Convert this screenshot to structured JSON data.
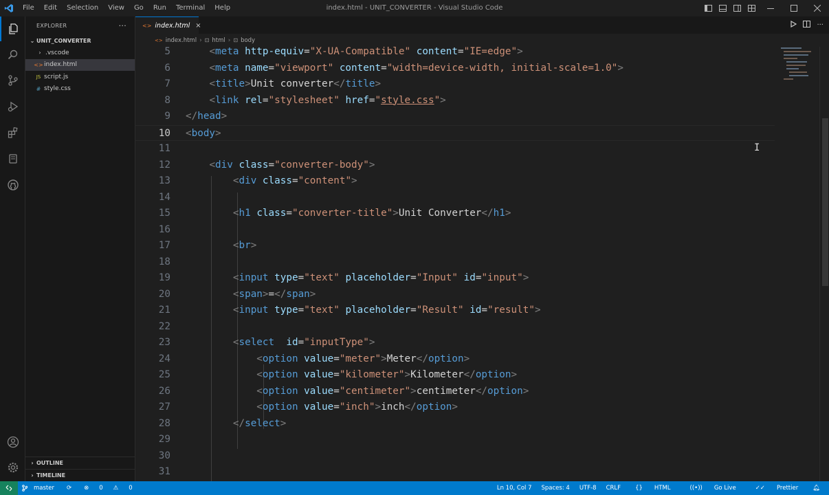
{
  "window": {
    "title": "index.html - UNIT_CONVERTER - Visual Studio Code",
    "menu": [
      "File",
      "Edit",
      "Selection",
      "View",
      "Go",
      "Run",
      "Terminal",
      "Help"
    ]
  },
  "sidebar": {
    "header": "EXPLORER",
    "more": "···",
    "folder": "UNIT_CONVERTER",
    "items": [
      {
        "label": ".vscode",
        "icon": "chevron-right-icon"
      },
      {
        "label": "index.html",
        "icon": "html-file-icon"
      },
      {
        "label": "script.js",
        "icon": "js-file-icon"
      },
      {
        "label": "style.css",
        "icon": "css-file-icon"
      }
    ],
    "sections": [
      "OUTLINE",
      "TIMELINE"
    ]
  },
  "editor": {
    "tab": {
      "label": "index.html",
      "close": "×"
    },
    "breadcrumb": [
      "index.html",
      "html",
      "body"
    ],
    "lines": [
      {
        "n": "5",
        "t": [
          [
            "",
            "    "
          ],
          [
            "pb",
            "<"
          ],
          [
            "tg",
            "meta"
          ],
          [
            "tx",
            " "
          ],
          [
            "at",
            "http-equiv"
          ],
          [
            "tx",
            "="
          ],
          [
            "st",
            "\"X-UA-Compatible\""
          ],
          [
            "tx",
            " "
          ],
          [
            "at",
            "content"
          ],
          [
            "tx",
            "="
          ],
          [
            "st",
            "\"IE=edge\""
          ],
          [
            "pb",
            ">"
          ]
        ]
      },
      {
        "n": "6",
        "t": [
          [
            "",
            "    "
          ],
          [
            "pb",
            "<"
          ],
          [
            "tg",
            "meta"
          ],
          [
            "tx",
            " "
          ],
          [
            "at",
            "name"
          ],
          [
            "tx",
            "="
          ],
          [
            "st",
            "\"viewport\""
          ],
          [
            "tx",
            " "
          ],
          [
            "at",
            "content"
          ],
          [
            "tx",
            "="
          ],
          [
            "st",
            "\"width=device-width, initial-scale=1.0\""
          ],
          [
            "pb",
            ">"
          ]
        ]
      },
      {
        "n": "7",
        "t": [
          [
            "",
            "    "
          ],
          [
            "pb",
            "<"
          ],
          [
            "tg",
            "title"
          ],
          [
            "pb",
            ">"
          ],
          [
            "tx",
            "Unit converter"
          ],
          [
            "pb",
            "</"
          ],
          [
            "tg",
            "title"
          ],
          [
            "pb",
            ">"
          ]
        ]
      },
      {
        "n": "8",
        "t": [
          [
            "",
            "    "
          ],
          [
            "pb",
            "<"
          ],
          [
            "tg",
            "link"
          ],
          [
            "tx",
            " "
          ],
          [
            "at",
            "rel"
          ],
          [
            "tx",
            "="
          ],
          [
            "st",
            "\"stylesheet\""
          ],
          [
            "tx",
            " "
          ],
          [
            "at",
            "href"
          ],
          [
            "tx",
            "="
          ],
          [
            "st",
            "\""
          ],
          [
            "st ul",
            "style.css"
          ],
          [
            "st",
            "\""
          ],
          [
            "pb",
            ">"
          ]
        ]
      },
      {
        "n": "9",
        "t": [
          [
            "pb",
            "</"
          ],
          [
            "tg",
            "head"
          ],
          [
            "pb",
            ">"
          ]
        ]
      },
      {
        "n": "10",
        "t": [
          [
            "pb",
            "<"
          ],
          [
            "tg",
            "body"
          ],
          [
            "pb",
            ">"
          ]
        ]
      },
      {
        "n": "11",
        "t": []
      },
      {
        "n": "12",
        "t": [
          [
            "",
            "    "
          ],
          [
            "pb",
            "<"
          ],
          [
            "tg",
            "div"
          ],
          [
            "tx",
            " "
          ],
          [
            "at",
            "class"
          ],
          [
            "tx",
            "="
          ],
          [
            "st",
            "\"converter-body\""
          ],
          [
            "pb",
            ">"
          ]
        ]
      },
      {
        "n": "13",
        "t": [
          [
            "",
            "        "
          ],
          [
            "pb",
            "<"
          ],
          [
            "tg",
            "div"
          ],
          [
            "tx",
            " "
          ],
          [
            "at",
            "class"
          ],
          [
            "tx",
            "="
          ],
          [
            "st",
            "\"content\""
          ],
          [
            "pb",
            ">"
          ]
        ]
      },
      {
        "n": "14",
        "t": []
      },
      {
        "n": "15",
        "t": [
          [
            "",
            "        "
          ],
          [
            "pb",
            "<"
          ],
          [
            "tg",
            "h1"
          ],
          [
            "tx",
            " "
          ],
          [
            "at",
            "class"
          ],
          [
            "tx",
            "="
          ],
          [
            "st",
            "\"converter-title\""
          ],
          [
            "pb",
            ">"
          ],
          [
            "tx",
            "Unit Converter"
          ],
          [
            "pb",
            "</"
          ],
          [
            "tg",
            "h1"
          ],
          [
            "pb",
            ">"
          ]
        ]
      },
      {
        "n": "16",
        "t": []
      },
      {
        "n": "17",
        "t": [
          [
            "",
            "        "
          ],
          [
            "pb",
            "<"
          ],
          [
            "tg",
            "br"
          ],
          [
            "pb",
            ">"
          ]
        ]
      },
      {
        "n": "18",
        "t": []
      },
      {
        "n": "19",
        "t": [
          [
            "",
            "        "
          ],
          [
            "pb",
            "<"
          ],
          [
            "tg",
            "input"
          ],
          [
            "tx",
            " "
          ],
          [
            "at",
            "type"
          ],
          [
            "tx",
            "="
          ],
          [
            "st",
            "\"text\""
          ],
          [
            "tx",
            " "
          ],
          [
            "at",
            "placeholder"
          ],
          [
            "tx",
            "="
          ],
          [
            "st",
            "\"Input\""
          ],
          [
            "tx",
            " "
          ],
          [
            "at",
            "id"
          ],
          [
            "tx",
            "="
          ],
          [
            "st",
            "\"input\""
          ],
          [
            "pb",
            ">"
          ]
        ]
      },
      {
        "n": "20",
        "t": [
          [
            "",
            "        "
          ],
          [
            "pb",
            "<"
          ],
          [
            "tg",
            "span"
          ],
          [
            "pb",
            ">"
          ],
          [
            "tx",
            "="
          ],
          [
            "pb",
            "</"
          ],
          [
            "tg",
            "span"
          ],
          [
            "pb",
            ">"
          ]
        ]
      },
      {
        "n": "21",
        "t": [
          [
            "",
            "        "
          ],
          [
            "pb",
            "<"
          ],
          [
            "tg",
            "input"
          ],
          [
            "tx",
            " "
          ],
          [
            "at",
            "type"
          ],
          [
            "tx",
            "="
          ],
          [
            "st",
            "\"text\""
          ],
          [
            "tx",
            " "
          ],
          [
            "at",
            "placeholder"
          ],
          [
            "tx",
            "="
          ],
          [
            "st",
            "\"Result\""
          ],
          [
            "tx",
            " "
          ],
          [
            "at",
            "id"
          ],
          [
            "tx",
            "="
          ],
          [
            "st",
            "\"result\""
          ],
          [
            "pb",
            ">"
          ]
        ]
      },
      {
        "n": "22",
        "t": []
      },
      {
        "n": "23",
        "t": [
          [
            "",
            "        "
          ],
          [
            "pb",
            "<"
          ],
          [
            "tg",
            "select"
          ],
          [
            "tx",
            "  "
          ],
          [
            "at",
            "id"
          ],
          [
            "tx",
            "="
          ],
          [
            "st",
            "\"inputType\""
          ],
          [
            "pb",
            ">"
          ]
        ]
      },
      {
        "n": "24",
        "t": [
          [
            "",
            "            "
          ],
          [
            "pb",
            "<"
          ],
          [
            "tg",
            "option"
          ],
          [
            "tx",
            " "
          ],
          [
            "at",
            "value"
          ],
          [
            "tx",
            "="
          ],
          [
            "st",
            "\"meter\""
          ],
          [
            "pb",
            ">"
          ],
          [
            "tx",
            "Meter"
          ],
          [
            "pb",
            "</"
          ],
          [
            "tg",
            "option"
          ],
          [
            "pb",
            ">"
          ]
        ]
      },
      {
        "n": "25",
        "t": [
          [
            "",
            "            "
          ],
          [
            "pb",
            "<"
          ],
          [
            "tg",
            "option"
          ],
          [
            "tx",
            " "
          ],
          [
            "at",
            "value"
          ],
          [
            "tx",
            "="
          ],
          [
            "st",
            "\"kilometer\""
          ],
          [
            "pb",
            ">"
          ],
          [
            "tx",
            "Kilometer"
          ],
          [
            "pb",
            "</"
          ],
          [
            "tg",
            "option"
          ],
          [
            "pb",
            ">"
          ]
        ]
      },
      {
        "n": "26",
        "t": [
          [
            "",
            "            "
          ],
          [
            "pb",
            "<"
          ],
          [
            "tg",
            "option"
          ],
          [
            "tx",
            " "
          ],
          [
            "at",
            "value"
          ],
          [
            "tx",
            "="
          ],
          [
            "st",
            "\"centimeter\""
          ],
          [
            "pb",
            ">"
          ],
          [
            "tx",
            "centimeter"
          ],
          [
            "pb",
            "</"
          ],
          [
            "tg",
            "option"
          ],
          [
            "pb",
            ">"
          ]
        ]
      },
      {
        "n": "27",
        "t": [
          [
            "",
            "            "
          ],
          [
            "pb",
            "<"
          ],
          [
            "tg",
            "option"
          ],
          [
            "tx",
            " "
          ],
          [
            "at",
            "value"
          ],
          [
            "tx",
            "="
          ],
          [
            "st",
            "\"inch\""
          ],
          [
            "pb",
            ">"
          ],
          [
            "tx",
            "inch"
          ],
          [
            "pb",
            "</"
          ],
          [
            "tg",
            "option"
          ],
          [
            "pb",
            ">"
          ]
        ]
      },
      {
        "n": "28",
        "t": [
          [
            "",
            "        "
          ],
          [
            "pb",
            "</"
          ],
          [
            "tg",
            "select"
          ],
          [
            "pb",
            ">"
          ]
        ]
      },
      {
        "n": "29",
        "t": []
      },
      {
        "n": "30",
        "t": []
      },
      {
        "n": "31",
        "t": []
      }
    ],
    "current_line": "10"
  },
  "statusbar": {
    "branch": "master",
    "errors": "0",
    "warnings": "0",
    "position": "Ln 10, Col 7",
    "spaces": "Spaces: 4",
    "encoding": "UTF-8",
    "eol": "CRLF",
    "language": "HTML",
    "golive": "Go Live",
    "prettier": "Prettier"
  },
  "colors": {
    "accent": "#007acc",
    "tag": "#569cd6",
    "attribute": "#9cdcfe",
    "string": "#ce9178"
  }
}
